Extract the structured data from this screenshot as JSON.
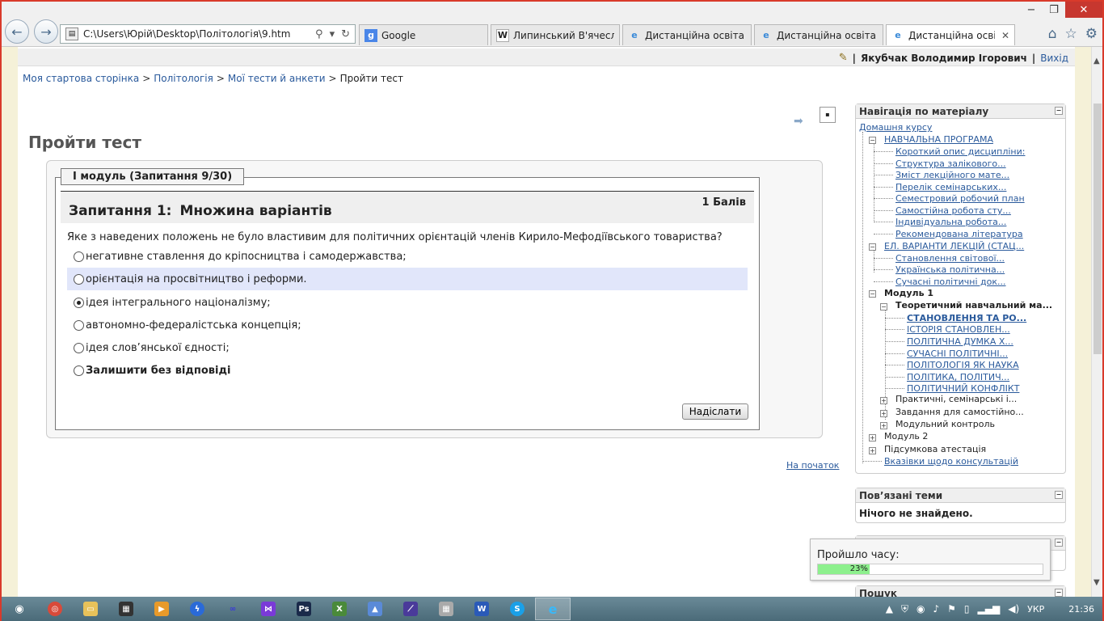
{
  "browser": {
    "address": "C:\\Users\\Юрій\\Desktop\\Політологія\\9.htm",
    "tabs": [
      {
        "label": "Google",
        "icon": "google-icon"
      },
      {
        "label": "Липинський В'ячеслав...",
        "icon": "wikipedia-icon"
      },
      {
        "label": "Дистанційна освіта в Т...",
        "icon": "ie-icon"
      },
      {
        "label": "Дистанційна освіта в Т...",
        "icon": "ie-icon"
      },
      {
        "label": "Дистанційна освіта ...",
        "icon": "ie-icon",
        "active": true
      }
    ],
    "window_controls": [
      "−",
      "❐",
      "✕"
    ]
  },
  "userbar": {
    "name": "Якубчак Володимир Ігорович",
    "separator": "|",
    "logout": "Вихід"
  },
  "breadcrumb": [
    {
      "label": "Моя стартова сторінка",
      "link": true
    },
    {
      "label": "Політологія",
      "link": true
    },
    {
      "label": "Мої тести й анкети",
      "link": true
    },
    {
      "label": "Пройти тест",
      "link": false
    }
  ],
  "breadcrumb_separator": ">",
  "page_title": "Пройти тест",
  "quiz": {
    "legend": "I модуль (Запитання 9/30)",
    "question_number": "Запитання 1:",
    "question_type": "Множина варіантів",
    "points": "1 Балів",
    "question_text": "Яке з наведених положень не було властивим для політичних орієнтацій членів Кирило-Мефодіївського товариства?",
    "answers": [
      {
        "label": "негативне ставлення до кріпосництва і самодержавства;",
        "checked": false,
        "highlight": false
      },
      {
        "label": "орієнтація на просвітництво і реформи.",
        "checked": false,
        "highlight": true
      },
      {
        "label": "ідея інтегрального націоналізму;",
        "checked": true,
        "highlight": false
      },
      {
        "label": "автономно-федералістська концепція;",
        "checked": false,
        "highlight": false
      },
      {
        "label": "ідея слов’янської єдності;",
        "checked": false,
        "highlight": false
      },
      {
        "label": "Залишити без відповіді",
        "checked": false,
        "highlight": false,
        "bold": true
      }
    ],
    "submit": "Надіслати"
  },
  "to_top": "На початок",
  "nav_block": {
    "title": "Навігація по матеріалу",
    "items": [
      {
        "label": "Домашня курсу"
      },
      {
        "label": "НАВЧАЛЬНА ПРОГРАМА"
      },
      {
        "label": "Короткий опис дисципліни:"
      },
      {
        "label": "Структура залікового..."
      },
      {
        "label": "Зміст лекційного мате..."
      },
      {
        "label": "Перелік семінарських..."
      },
      {
        "label": "Семестровий робочий план"
      },
      {
        "label": "Самостійна робота сту..."
      },
      {
        "label": "Індивідуальна робота..."
      },
      {
        "label": "Рекомендована література"
      },
      {
        "label": "ЕЛ. ВАРІАНТИ ЛЕКЦІЙ (СТАЦ..."
      },
      {
        "label": "Становлення світової..."
      },
      {
        "label": "Українська політична..."
      },
      {
        "label": "Сучасні політичні док..."
      },
      {
        "label": "Модуль 1"
      },
      {
        "label": "Теоретичний навчальний ма..."
      },
      {
        "label": "СТАНОВЛЕННЯ ТА РО..."
      },
      {
        "label": "ІСТОРІЯ СТАНОВЛЕН..."
      },
      {
        "label": "ПОЛІТИЧНА ДУМКА Х..."
      },
      {
        "label": "СУЧАСНІ ПОЛІТИЧНІ..."
      },
      {
        "label": "ПОЛІТОЛОГІЯ ЯК НАУКА"
      },
      {
        "label": "ПОЛІТИКА, ПОЛІТИЧ..."
      },
      {
        "label": "ПОЛІТИЧНИЙ КОНФЛІКТ"
      },
      {
        "label": "Практичні, семінарські і..."
      },
      {
        "label": "Завдання для самостійно..."
      },
      {
        "label": "Модульний контроль"
      },
      {
        "label": "Модуль 2"
      },
      {
        "label": "Підсумкова атестація"
      },
      {
        "label": "Вказівки щодо консультацій"
      }
    ]
  },
  "related_block": {
    "title": "Пов’язані теми",
    "empty": "Нічого не знайдено."
  },
  "search_block": {
    "title": "Пошук"
  },
  "timer": {
    "label": "Пройшло часу:",
    "progress_percent": 23,
    "progress_text": "23%"
  },
  "taskbar": {
    "language": "УКР",
    "time": "21:36"
  },
  "colors": {
    "link": "#2a5a9c",
    "highlight": "#e1e6fa",
    "progress": "#8df08d",
    "window_border": "#d93a2b"
  }
}
